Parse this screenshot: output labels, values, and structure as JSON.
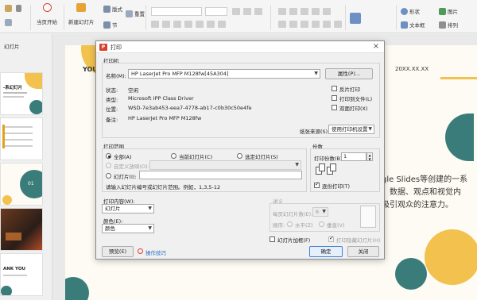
{
  "ribbon": {
    "switch_icon": "swap-icon",
    "play_label": "当页开始",
    "new_slide_label": "新建幻灯片",
    "layout_label": "版式",
    "section_label": "节",
    "reset_label": "重置",
    "shape_label": "形状",
    "picture_label": "图片",
    "textbox_label": "文本框",
    "arrange_label": "排列"
  },
  "thumbs": {
    "header": "幻灯片",
    "slide1_title": "-系幻灯片",
    "slide3_num": "01",
    "slide5_title": "ANK YOU"
  },
  "slide": {
    "header_left": "YOUR",
    "date": "20XX.XX.XX",
    "body_line1": "gle Slides等创建的一系",
    "body_line2": "、数据、观点和视觉内",
    "body_line3": "吸引观众的注意力。"
  },
  "dialog": {
    "title": "打印",
    "printer_section": "打印机",
    "name_label": "名称(M):",
    "printer_name": "HP LaserJet Pro MFP M128fw[45A304]",
    "properties_btn": "属性(P)...",
    "status_label": "状态:",
    "status_value": "空闲",
    "type_label": "类型:",
    "type_value": "Microsoft IPP Class Driver",
    "location_label": "位置:",
    "location_value": "WSD-7e3ab453-eea7-4778-ab17-c0b30c50e4fe",
    "comment_label": "备注:",
    "comment_value": "HP LaserJet Pro MFP M128fw",
    "reverse_print": "反片打印",
    "print_to_file": "打印到文件(L)",
    "duplex": "双面打印(X)",
    "paper_source_label": "纸张来源(S):",
    "paper_source_value": "使用打印机设置",
    "range_section": "打印范围",
    "all": "全部(A)",
    "current_slide": "当前幻灯片(C)",
    "selected_slide": "选定幻灯片(S)",
    "custom_show": "自定义放映(O):",
    "slides_opt": "幻灯片(I):",
    "hint": "请输入幻灯片编号或幻灯片范围。例如，1,3,5-12",
    "copies_section": "份数",
    "copies_label": "打印份数(B):",
    "copies_value": "1",
    "collate": "逐份打印(T)",
    "print_content_label": "打印内容(W):",
    "print_content_value": "幻灯片",
    "color_label": "颜色(E):",
    "color_value": "颜色",
    "handout_section": "讲义",
    "per_page_label": "每页幻灯片数(E):",
    "per_page_value": "6",
    "order_label": "顺序:",
    "horizontal": "水平(Z)",
    "vertical": "垂直(V)",
    "frame_slides": "幻灯片加框(F)",
    "print_hidden": "打印隐藏幻灯片(H)",
    "preview_btn": "预览(E)",
    "tips_link": "操作技巧",
    "ok_btn": "确定",
    "close_btn": "关闭"
  },
  "colors": {
    "accent_yellow": "#f2c14e",
    "accent_teal": "#3a7c7a",
    "dialog_icon": "#d9402b"
  }
}
